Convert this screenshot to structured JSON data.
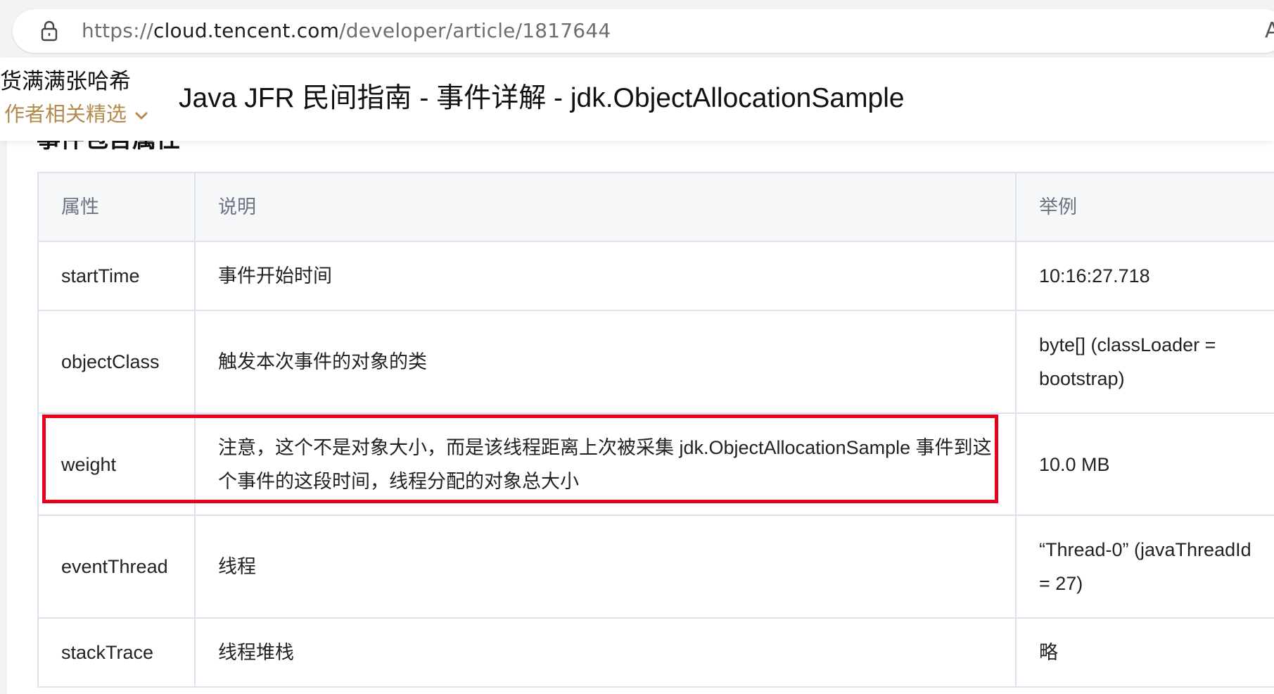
{
  "browser": {
    "url_scheme": "https://",
    "url_host": "cloud.tencent.com",
    "url_path": "/developer/article/1817644",
    "reader_icon_label": "A"
  },
  "header": {
    "author_name": "货满满张哈希",
    "author_related": "作者相关精选",
    "title": "Java JFR 民间指南 - 事件详解 - jdk.ObjectAllocationSample"
  },
  "section": {
    "heading": "事件包含属性"
  },
  "table": {
    "headers": [
      "属性",
      "说明",
      "举例"
    ],
    "rows": [
      {
        "attr": "startTime",
        "desc": "事件开始时间",
        "example": "10:16:27.718"
      },
      {
        "attr": "objectClass",
        "desc": "触发本次事件的对象的类",
        "example": "byte[] (classLoader = bootstrap)"
      },
      {
        "attr": "weight",
        "desc": "注意，这个不是对象大小，而是该线程距离上次被采集 jdk.ObjectAllocationSample 事件到这个事件的这段时间，线程分配的对象总大小",
        "example": "10.0 MB"
      },
      {
        "attr": "eventThread",
        "desc": "线程",
        "example": "“Thread-0” (javaThreadId = 27)"
      },
      {
        "attr": "stackTrace",
        "desc": "线程堆栈",
        "example": "略"
      }
    ]
  },
  "colors": {
    "highlight": "#e8001c",
    "accent_gold": "#b38a4c",
    "table_border": "#dde2ee"
  }
}
